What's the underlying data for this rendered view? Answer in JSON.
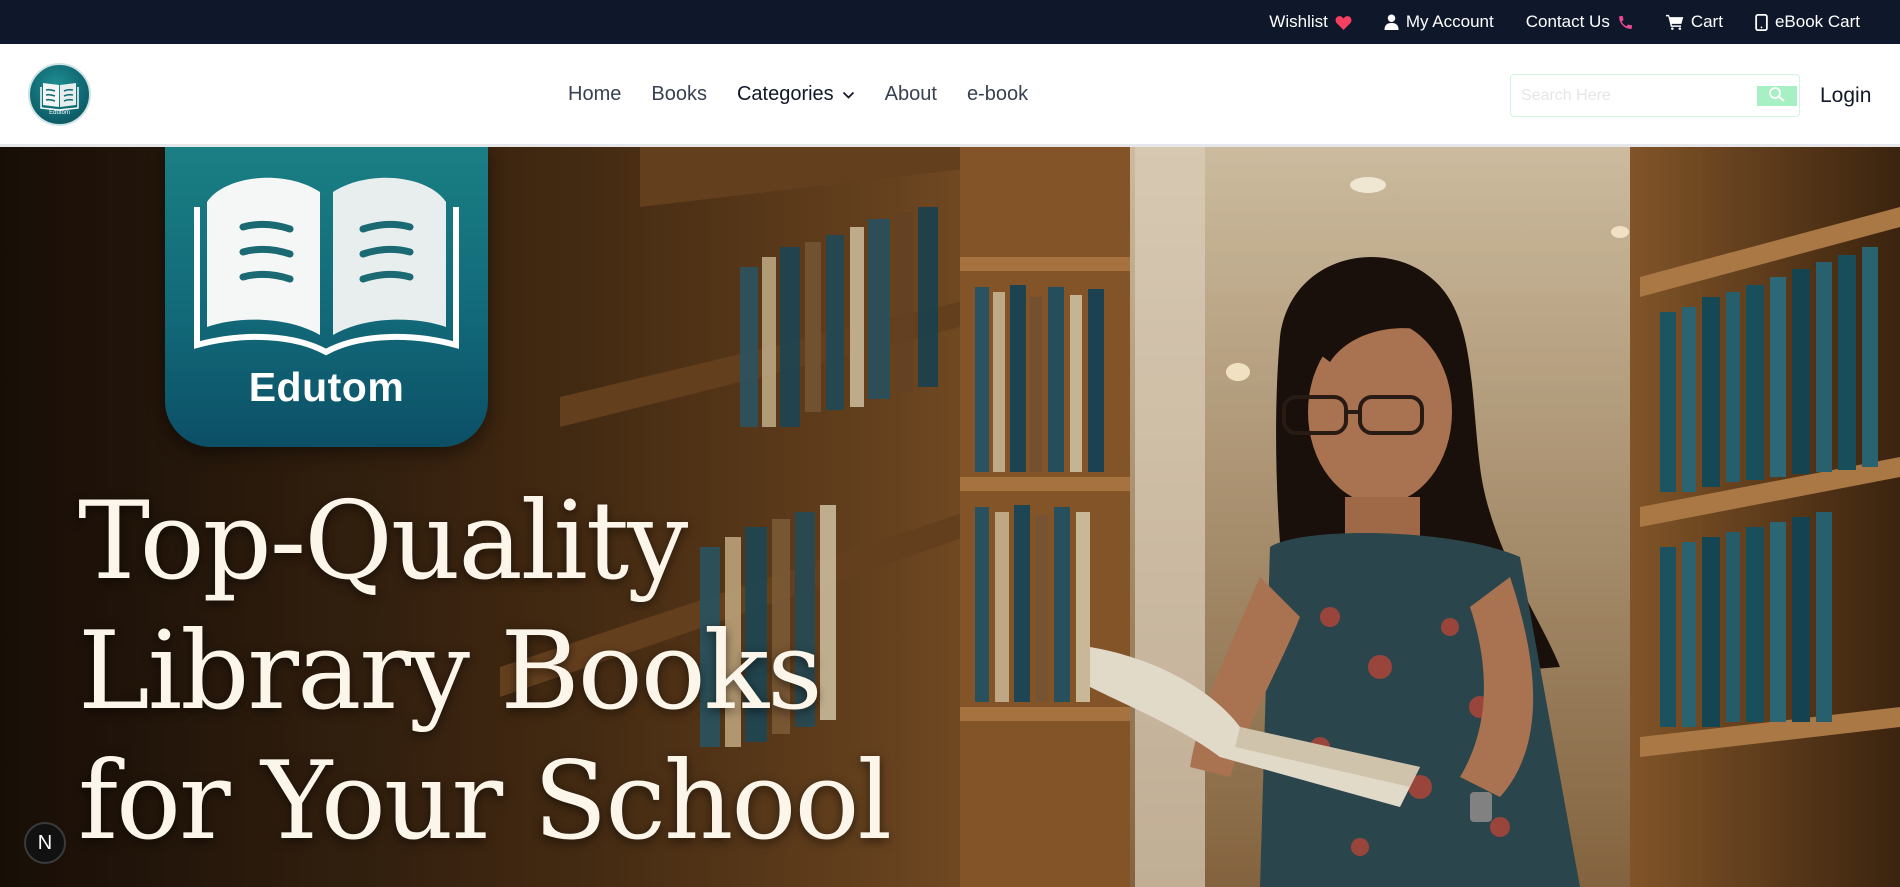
{
  "topbar": {
    "wishlist": "Wishlist",
    "my_account": "My Account",
    "contact_us": "Contact Us",
    "cart": "Cart",
    "ebook_cart": "eBook Cart",
    "icons": [
      "heart-icon",
      "user-icon",
      "phone-icon",
      "cart-icon",
      "tablet-icon"
    ],
    "colors": {
      "background": "#0f172a",
      "heart": "#f43f5e",
      "phone": "#ec4899"
    }
  },
  "header": {
    "logo_mini_text": "Edutom",
    "nav": {
      "home": "Home",
      "books": "Books",
      "categories": "Categories",
      "about": "About",
      "ebook": "e-book"
    },
    "search": {
      "placeholder": "Search Here",
      "value": ""
    },
    "login": "Login"
  },
  "hero": {
    "brand": "Edutom",
    "headline_line1": "Top-Quality",
    "headline_line2": "Library Books",
    "headline_line3": "for Your School"
  },
  "badge": {
    "label": "N"
  }
}
